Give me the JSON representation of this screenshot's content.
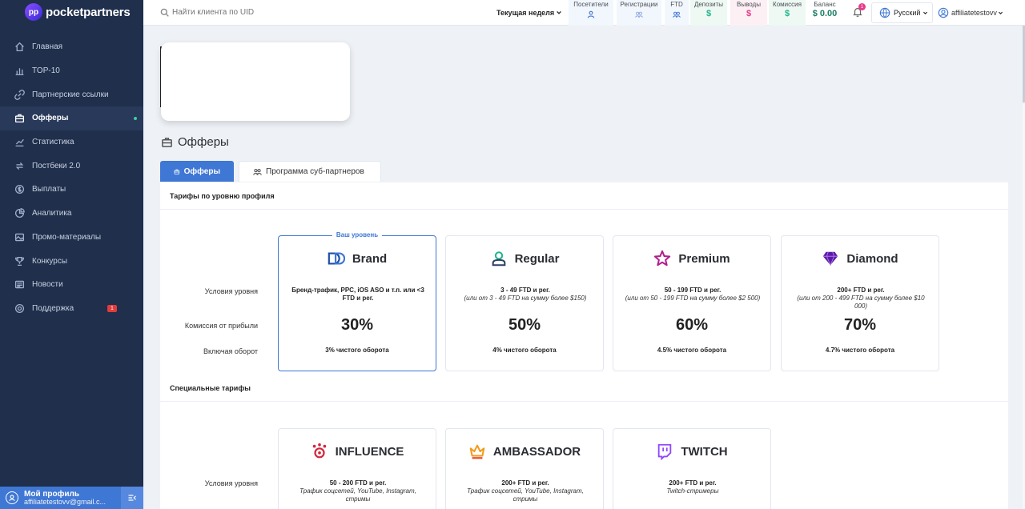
{
  "brand": {
    "name": "pocketpartners"
  },
  "sidebar": {
    "items": [
      {
        "label": "Главная",
        "icon": "home-icon"
      },
      {
        "label": "TOP-10",
        "icon": "chart-bars-icon"
      },
      {
        "label": "Партнерские ссылки",
        "icon": "link-icon"
      },
      {
        "label": "Офферы",
        "icon": "briefcase-icon",
        "active": true
      },
      {
        "label": "Статистика",
        "icon": "line-chart-icon"
      },
      {
        "label": "Постбеки 2.0",
        "icon": "postback-icon"
      },
      {
        "label": "Выплаты",
        "icon": "dollar-icon"
      },
      {
        "label": "Аналитика",
        "icon": "analytics-icon"
      },
      {
        "label": "Промо-материалы",
        "icon": "image-icon"
      },
      {
        "label": "Конкурсы",
        "icon": "trophy-icon"
      },
      {
        "label": "Новости",
        "icon": "news-icon"
      },
      {
        "label": "Поддержка",
        "icon": "support-icon",
        "badge": "1"
      }
    ],
    "profile": {
      "name": "Мой профиль",
      "email": "affiliatetestovv@gmail.c..."
    }
  },
  "topbar": {
    "search_placeholder": "Найти клиента по UID",
    "period": "Текущая неделя",
    "stats": [
      {
        "label": "Посетители",
        "icon": "user-icon"
      },
      {
        "label": "Регистрации",
        "icon": "users-icon"
      },
      {
        "label": "FTD",
        "icon": "users-icon"
      },
      {
        "label": "Депозиты",
        "icon": "dollar-icon"
      },
      {
        "label": "Выводы",
        "icon": "dollar-icon"
      },
      {
        "label": "Комиссия",
        "icon": "dollar-icon"
      },
      {
        "label": "Баланс",
        "value": "$ 0.00"
      }
    ],
    "notifications": "1",
    "language": "Русский",
    "user": "affiliatetestovv"
  },
  "page": {
    "title": "Офферы",
    "tabs": [
      {
        "label": "Офферы",
        "active": true
      },
      {
        "label": "Программа суб-партнеров",
        "active": false
      }
    ]
  },
  "tiers": {
    "section_title": "Тарифы по уровню профиля",
    "row_labels": {
      "conditions": "Условия уровня",
      "commission": "Комиссия от прибыли",
      "turnover": "Включая оборот"
    },
    "current_label": "Ваш уровень",
    "cards": [
      {
        "name": "Brand",
        "icon": "brand-icon",
        "cond_main": "Бренд-трафик, PPC, iOS ASO и т.п. или <3 FTD и рег.",
        "cond_sub": "",
        "percent": "30%",
        "turnover": "3% чистого оборота",
        "current": true
      },
      {
        "name": "Regular",
        "icon": "regular-user-icon",
        "cond_main": "3 - 49 FTD и рег.",
        "cond_sub": "(или от 3 - 49 FTD на сумму более $150)",
        "percent": "50%",
        "turnover": "4% чистого оборота"
      },
      {
        "name": "Premium",
        "icon": "star-icon",
        "cond_main": "50 - 199 FTD и рег.",
        "cond_sub": "(или от 50 - 199 FTD на сумму более $2 500)",
        "percent": "60%",
        "turnover": "4.5% чистого оборота"
      },
      {
        "name": "Diamond",
        "icon": "diamond-icon",
        "cond_main": "200+ FTD и рег.",
        "cond_sub": "(или от 200 - 499 FTD на сумму более $10 000)",
        "percent": "70%",
        "turnover": "4.7% чистого оборота"
      }
    ]
  },
  "special": {
    "section_title": "Специальные тарифы",
    "row_label": "Условия уровня",
    "cards": [
      {
        "name": "INFLUENCE",
        "icon": "influence-icon",
        "cond_main": "50 - 200 FTD и рег.",
        "cond_sub": "Трафик соцсетей, YouTube, Instagram, стримы"
      },
      {
        "name": "AMBASSADOR",
        "icon": "crown-icon",
        "cond_main": "200+ FTD и рег.",
        "cond_sub": "Трафик соцсетей, YouTube, Instagram, стримы"
      },
      {
        "name": "TWITCH",
        "icon": "twitch-icon",
        "cond_main": "200+ FTD и рег.",
        "cond_sub": "Twitch-стримеры"
      }
    ]
  },
  "colors": {
    "sidebar_bg": "#1f2f4c",
    "accent": "#3f77d4",
    "green": "#1fb58a",
    "pink": "#e83a8a"
  }
}
